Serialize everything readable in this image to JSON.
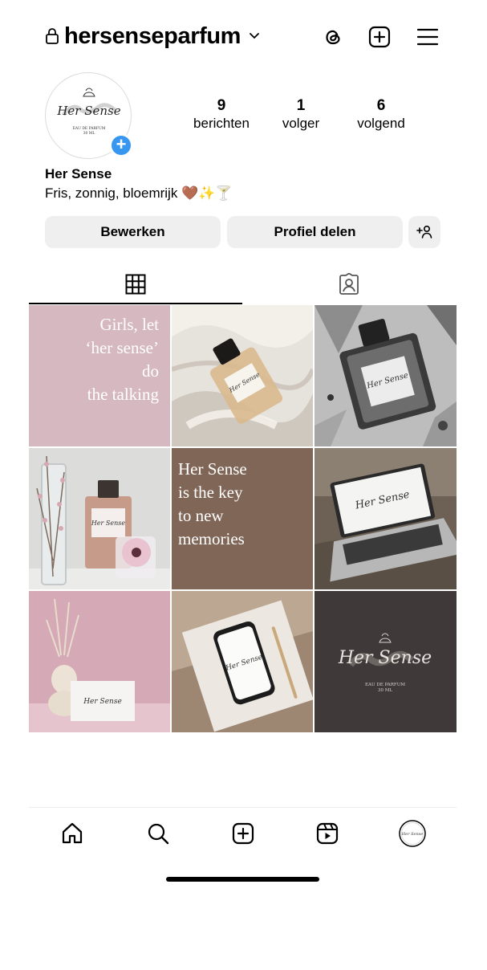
{
  "header": {
    "username": "hersenseparfum",
    "icons": [
      "lock-icon",
      "chevron-down-icon",
      "threads-icon",
      "create-post-icon",
      "menu-icon"
    ]
  },
  "profile": {
    "stats": [
      {
        "value": "9",
        "label": "berichten"
      },
      {
        "value": "1",
        "label": "volger"
      },
      {
        "value": "6",
        "label": "volgend"
      }
    ],
    "display_name": "Her Sense",
    "bio": "Fris, zonnig, bloemrijk 🤎✨🍸",
    "avatar_logo_text": "Her Sense",
    "avatar_sub_text": "EAU DE PARFUM 30 ML"
  },
  "actions": {
    "edit_label": "Bewerken",
    "share_label": "Profiel delen",
    "discover_icon": "add-person-icon"
  },
  "tabs": [
    {
      "name": "grid",
      "icon": "grid-icon",
      "active": true
    },
    {
      "name": "tagged",
      "icon": "tagged-person-icon",
      "active": false
    }
  ],
  "posts": {
    "post1_lines": [
      "Girls, let",
      "‘her sense’",
      "do",
      "the talking"
    ],
    "post5_lines": [
      "Her Sense",
      "is the key",
      "to new",
      "memories"
    ],
    "post9_logo": "Her Sense",
    "post9_sub": "EAU DE PARFUM 30 ML"
  },
  "colors": {
    "accent_blue": "#3797f0",
    "pink_tile": "#d6b9c0",
    "brown_tile": "#7f6657",
    "dark_tile": "#3f3a39"
  },
  "bottom_nav": [
    "home-icon",
    "search-icon",
    "create-icon",
    "reels-icon",
    "profile-avatar-icon"
  ]
}
